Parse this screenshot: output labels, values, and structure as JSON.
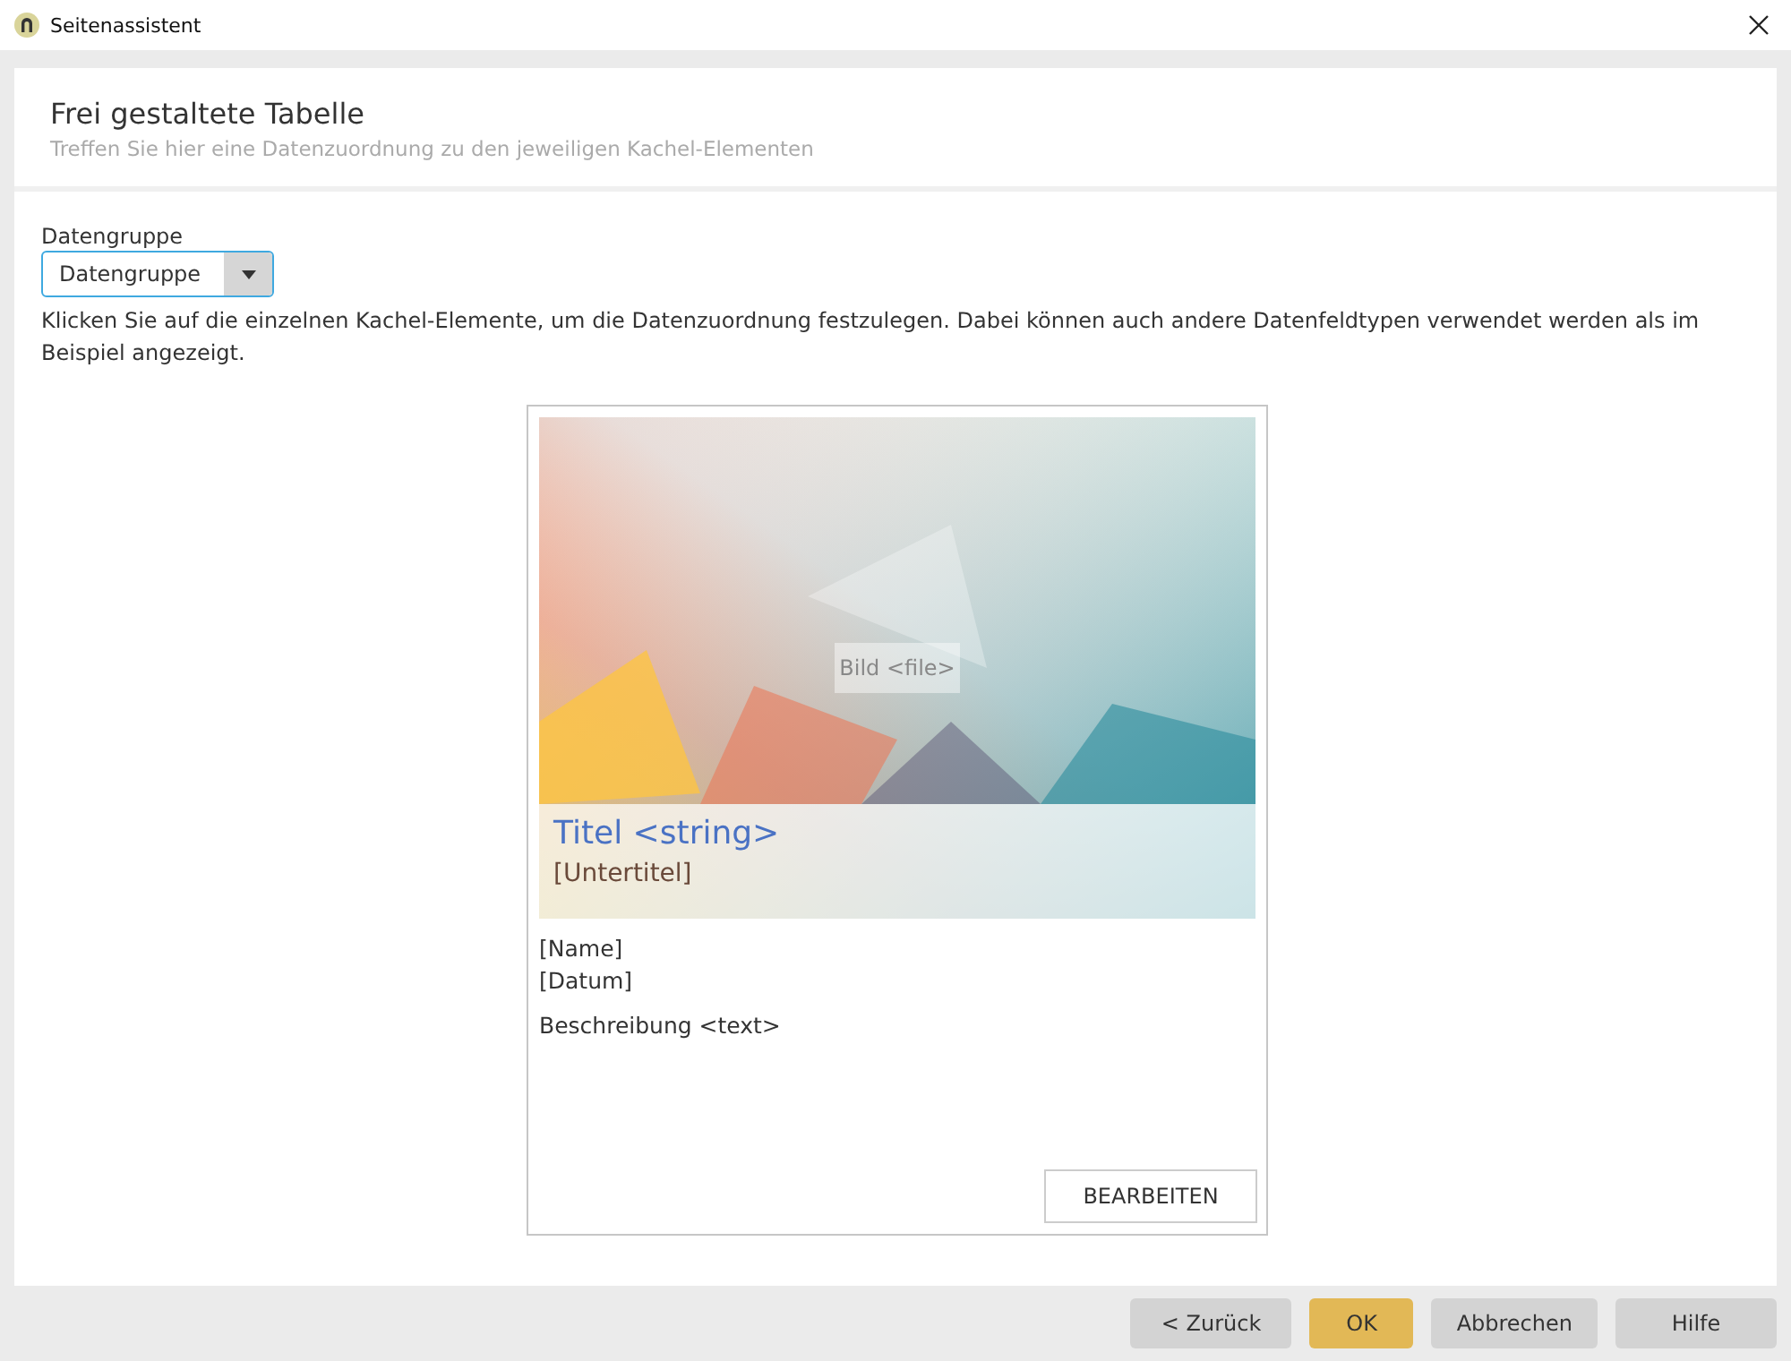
{
  "window": {
    "title": "Seitenassistent"
  },
  "header": {
    "title": "Frei gestaltete Tabelle",
    "subtitle": "Treffen Sie hier eine Datenzuordnung zu den jeweiligen Kachel-Elementen"
  },
  "data_group": {
    "label": "Datengruppe",
    "value": "Datengruppe"
  },
  "instructions": "Klicken Sie auf die einzelnen Kachel-Elemente, um die Datenzuordnung festzulegen. Dabei können auch andere Datenfeldtypen verwendet werden als im Beispiel angezeigt.",
  "tile": {
    "image_label": "Bild <file>",
    "title": "Titel <string>",
    "subtitle": "[Untertitel]",
    "name": "[Name]",
    "date": "[Datum]",
    "description": "Beschreibung <text>",
    "button": "BEARBEITEN"
  },
  "buttons": [
    {
      "label": "< Zurück",
      "primary": false
    },
    {
      "label": "OK",
      "primary": true
    },
    {
      "label": "Abbrechen",
      "primary": false
    },
    {
      "label": "Hilfe",
      "primary": false
    }
  ]
}
